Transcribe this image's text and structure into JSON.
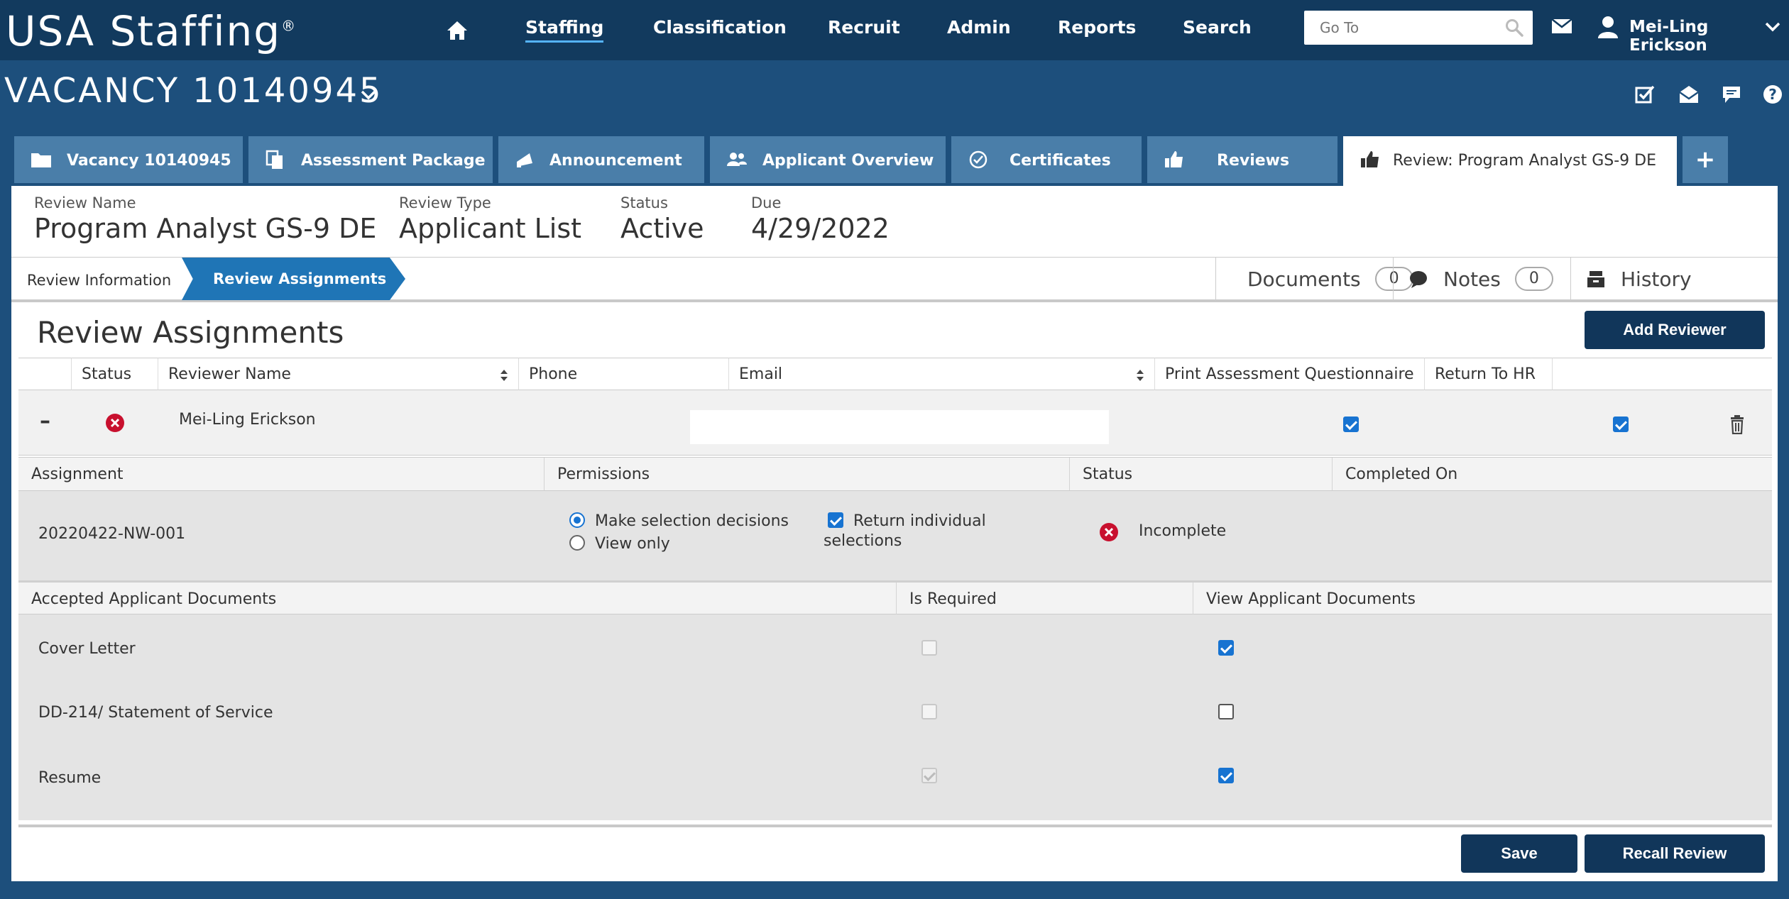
{
  "app": {
    "logo": "USA Staffing",
    "logo_mark": "®"
  },
  "nav": {
    "items": [
      "Staffing",
      "Classification",
      "Recruit",
      "Admin",
      "Reports",
      "Search"
    ],
    "active": "Staffing",
    "goto_placeholder": "Go To",
    "user": "Mei-Ling Erickson"
  },
  "vacancy": {
    "title": "VACANCY 10140945"
  },
  "tabs": [
    {
      "label": "Vacancy 10140945",
      "icon": "folder-icon"
    },
    {
      "label": "Assessment Package",
      "icon": "copy-icon"
    },
    {
      "label": "Announcement",
      "icon": "megaphone-icon"
    },
    {
      "label": "Applicant Overview",
      "icon": "users-icon"
    },
    {
      "label": "Certificates",
      "icon": "check-circle-icon"
    },
    {
      "label": "Reviews",
      "icon": "thumbs-up-icon"
    },
    {
      "label": "Review: Program Analyst GS-9 DE",
      "icon": "thumbs-up-icon",
      "active": true
    }
  ],
  "tab_plus": "+",
  "review": {
    "name_label": "Review Name",
    "name": "Program Analyst GS-9 DE",
    "type_label": "Review Type",
    "type": "Applicant List",
    "status_label": "Status",
    "status": "Active",
    "due_label": "Due",
    "due": "4/29/2022"
  },
  "subnav": {
    "crumb1": "Review Information",
    "crumb2": "Review Assignments",
    "documents_label": "Documents",
    "documents_count": "0",
    "notes_label": "Notes",
    "notes_count": "0",
    "history_label": "History"
  },
  "assignments": {
    "title": "Review Assignments",
    "add_button": "Add Reviewer",
    "columns": [
      "Status",
      "Reviewer Name",
      "Phone",
      "Email",
      "Print Assessment Questionnaire",
      "Return To HR"
    ],
    "collapse": "–",
    "reviewer": {
      "name": "Mei-Ling Erickson",
      "print_questionnaire": true,
      "return_to_hr": true
    },
    "assignment_headers": [
      "Assignment",
      "Permissions",
      "Status",
      "Completed On"
    ],
    "assignment": {
      "id": "20220422-NW-001",
      "perm_make": "Make selection decisions",
      "perm_view": "View only",
      "perm_selected": "make",
      "return_individual_1": "Return individual",
      "return_individual_2": "selections",
      "return_individual": true,
      "status": "Incomplete",
      "completed_on": ""
    },
    "doc_headers": [
      "Accepted Applicant Documents",
      "Is Required",
      "View Applicant Documents"
    ],
    "documents": [
      {
        "name": "Cover Letter",
        "required": false,
        "view": true
      },
      {
        "name": "DD-214/ Statement of Service",
        "required": false,
        "view": false
      },
      {
        "name": "Resume",
        "required": true,
        "view": true
      }
    ]
  },
  "footer": {
    "save": "Save",
    "recall": "Recall Review"
  },
  "colors": {
    "nav_bg": "#123a5e",
    "page_bg": "#1d4f7c",
    "tab_bg": "#4a7ea9",
    "accent": "#1f75b6",
    "button": "#11365a",
    "error": "#c8102e"
  }
}
